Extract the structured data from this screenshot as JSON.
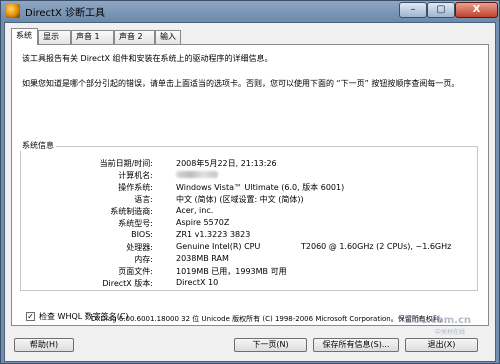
{
  "window": {
    "title": "DirectX 诊断工具",
    "min": "–",
    "max": "▢",
    "close": "X"
  },
  "tabs": [
    {
      "label": "系统"
    },
    {
      "label": "显示"
    },
    {
      "label": "声音 1"
    },
    {
      "label": "声音 2"
    },
    {
      "label": "输入"
    }
  ],
  "intro": {
    "p1": "该工具报告有关 DirectX 组件和安装在系统上的驱动程序的详细信息。",
    "p2": "如果您知道是哪个部分引起的错误，请单击上面适当的选项卡。否则，您可以使用下面的 “下一页” 按钮按顺序查阅每一页。"
  },
  "sysinfo": {
    "group_label": "系统信息",
    "rows": [
      {
        "label": "当前日期/时间:",
        "value": "2008年5月22日, 21:13:26"
      },
      {
        "label": "计算机名:",
        "value": ""
      },
      {
        "label": "操作系统:",
        "value": "Windows Vista™ Ultimate (6.0, 版本 6001)"
      },
      {
        "label": "语言:",
        "value": "中文 (简体) (区域设置: 中文 (简体))"
      },
      {
        "label": "系统制造商:",
        "value": "Acer, inc."
      },
      {
        "label": "系统型号:",
        "value": "Aspire 5570Z"
      },
      {
        "label": "BIOS:",
        "value": "ZR1 v1.3223 3823"
      },
      {
        "label": "处理器:",
        "value": "Genuine Intel(R) CPU",
        "value2": "T2060  @ 1.60GHz (2 CPUs), ~1.6GHz"
      },
      {
        "label": "内存:",
        "value": "2038MB RAM"
      },
      {
        "label": "页面文件:",
        "value": "1019MB 已用，1993MB 可用"
      },
      {
        "label": "DirectX 版本:",
        "value": "DirectX 10"
      }
    ]
  },
  "whql": {
    "label": "检查 WHQL 数字签名(C)",
    "checked": true,
    "mark": "✓"
  },
  "footer": "DxDiag 6.00.6001.18000 32 位 Unicode 版权所有 (C) 1998-2006 Microsoft Corporation。保留所有权利。",
  "buttons": {
    "help": "帮助(H)",
    "next": "下一页(N)",
    "save": "保存所有信息(S)...",
    "exit": "退出(X)"
  },
  "watermark": {
    "line1": "ZOL.com.cn",
    "line2": "中关村在线"
  }
}
